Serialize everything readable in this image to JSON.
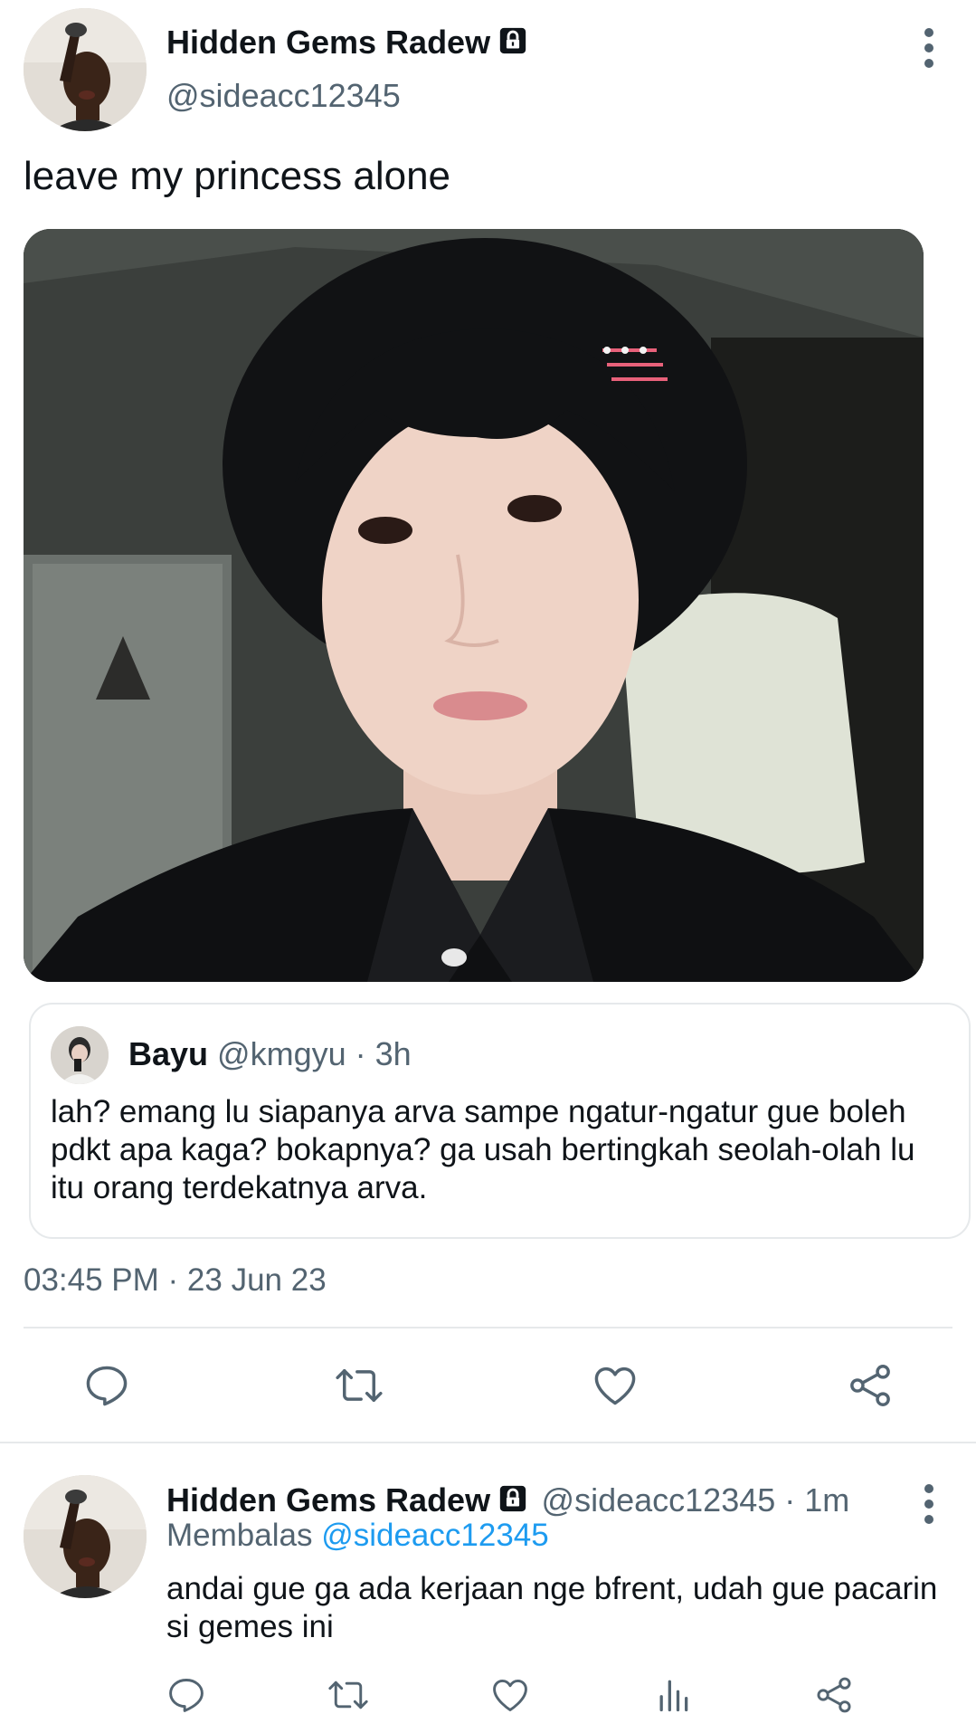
{
  "main_tweet": {
    "author": {
      "display_name": "Hidden Gems Radew",
      "handle": "@sideacc12345",
      "locked": true,
      "avatar": "avatar-photo"
    },
    "text": "leave my princess alone",
    "media": {
      "kind": "photo",
      "hairclip_color": "#e8617a"
    },
    "quoted_tweet": {
      "display_name": "Bayu",
      "meta": "@kmgyu · 3h",
      "text": "lah? emang lu siapanya arva sampe ngatur-ngatur gue boleh pdkt apa kaga? bokapnya? ga usah bertingkah seolah-olah lu itu orang terdekatnya arva."
    },
    "timestamp": "03:45 PM · 23 Jun 23",
    "actions": [
      "reply-icon",
      "retweet-icon",
      "like-icon",
      "share-icon"
    ]
  },
  "reply_tweet": {
    "author": {
      "display_name": "Hidden Gems Radew",
      "meta": "@sideacc12345 · 1m",
      "locked": true
    },
    "replying_to_label": "Membalas",
    "replying_to_handle": "@sideacc12345",
    "text": "andai gue ga ada kerjaan nge bfrent, udah gue pacarin si gemes ini",
    "actions": [
      "reply-icon",
      "retweet-icon",
      "like-icon",
      "views-icon",
      "share-icon"
    ]
  },
  "colors": {
    "text": "#0f1419",
    "secondary": "#536471",
    "link": "#1d9bf0",
    "divider": "#e6e9eb",
    "icon": "#536471"
  }
}
